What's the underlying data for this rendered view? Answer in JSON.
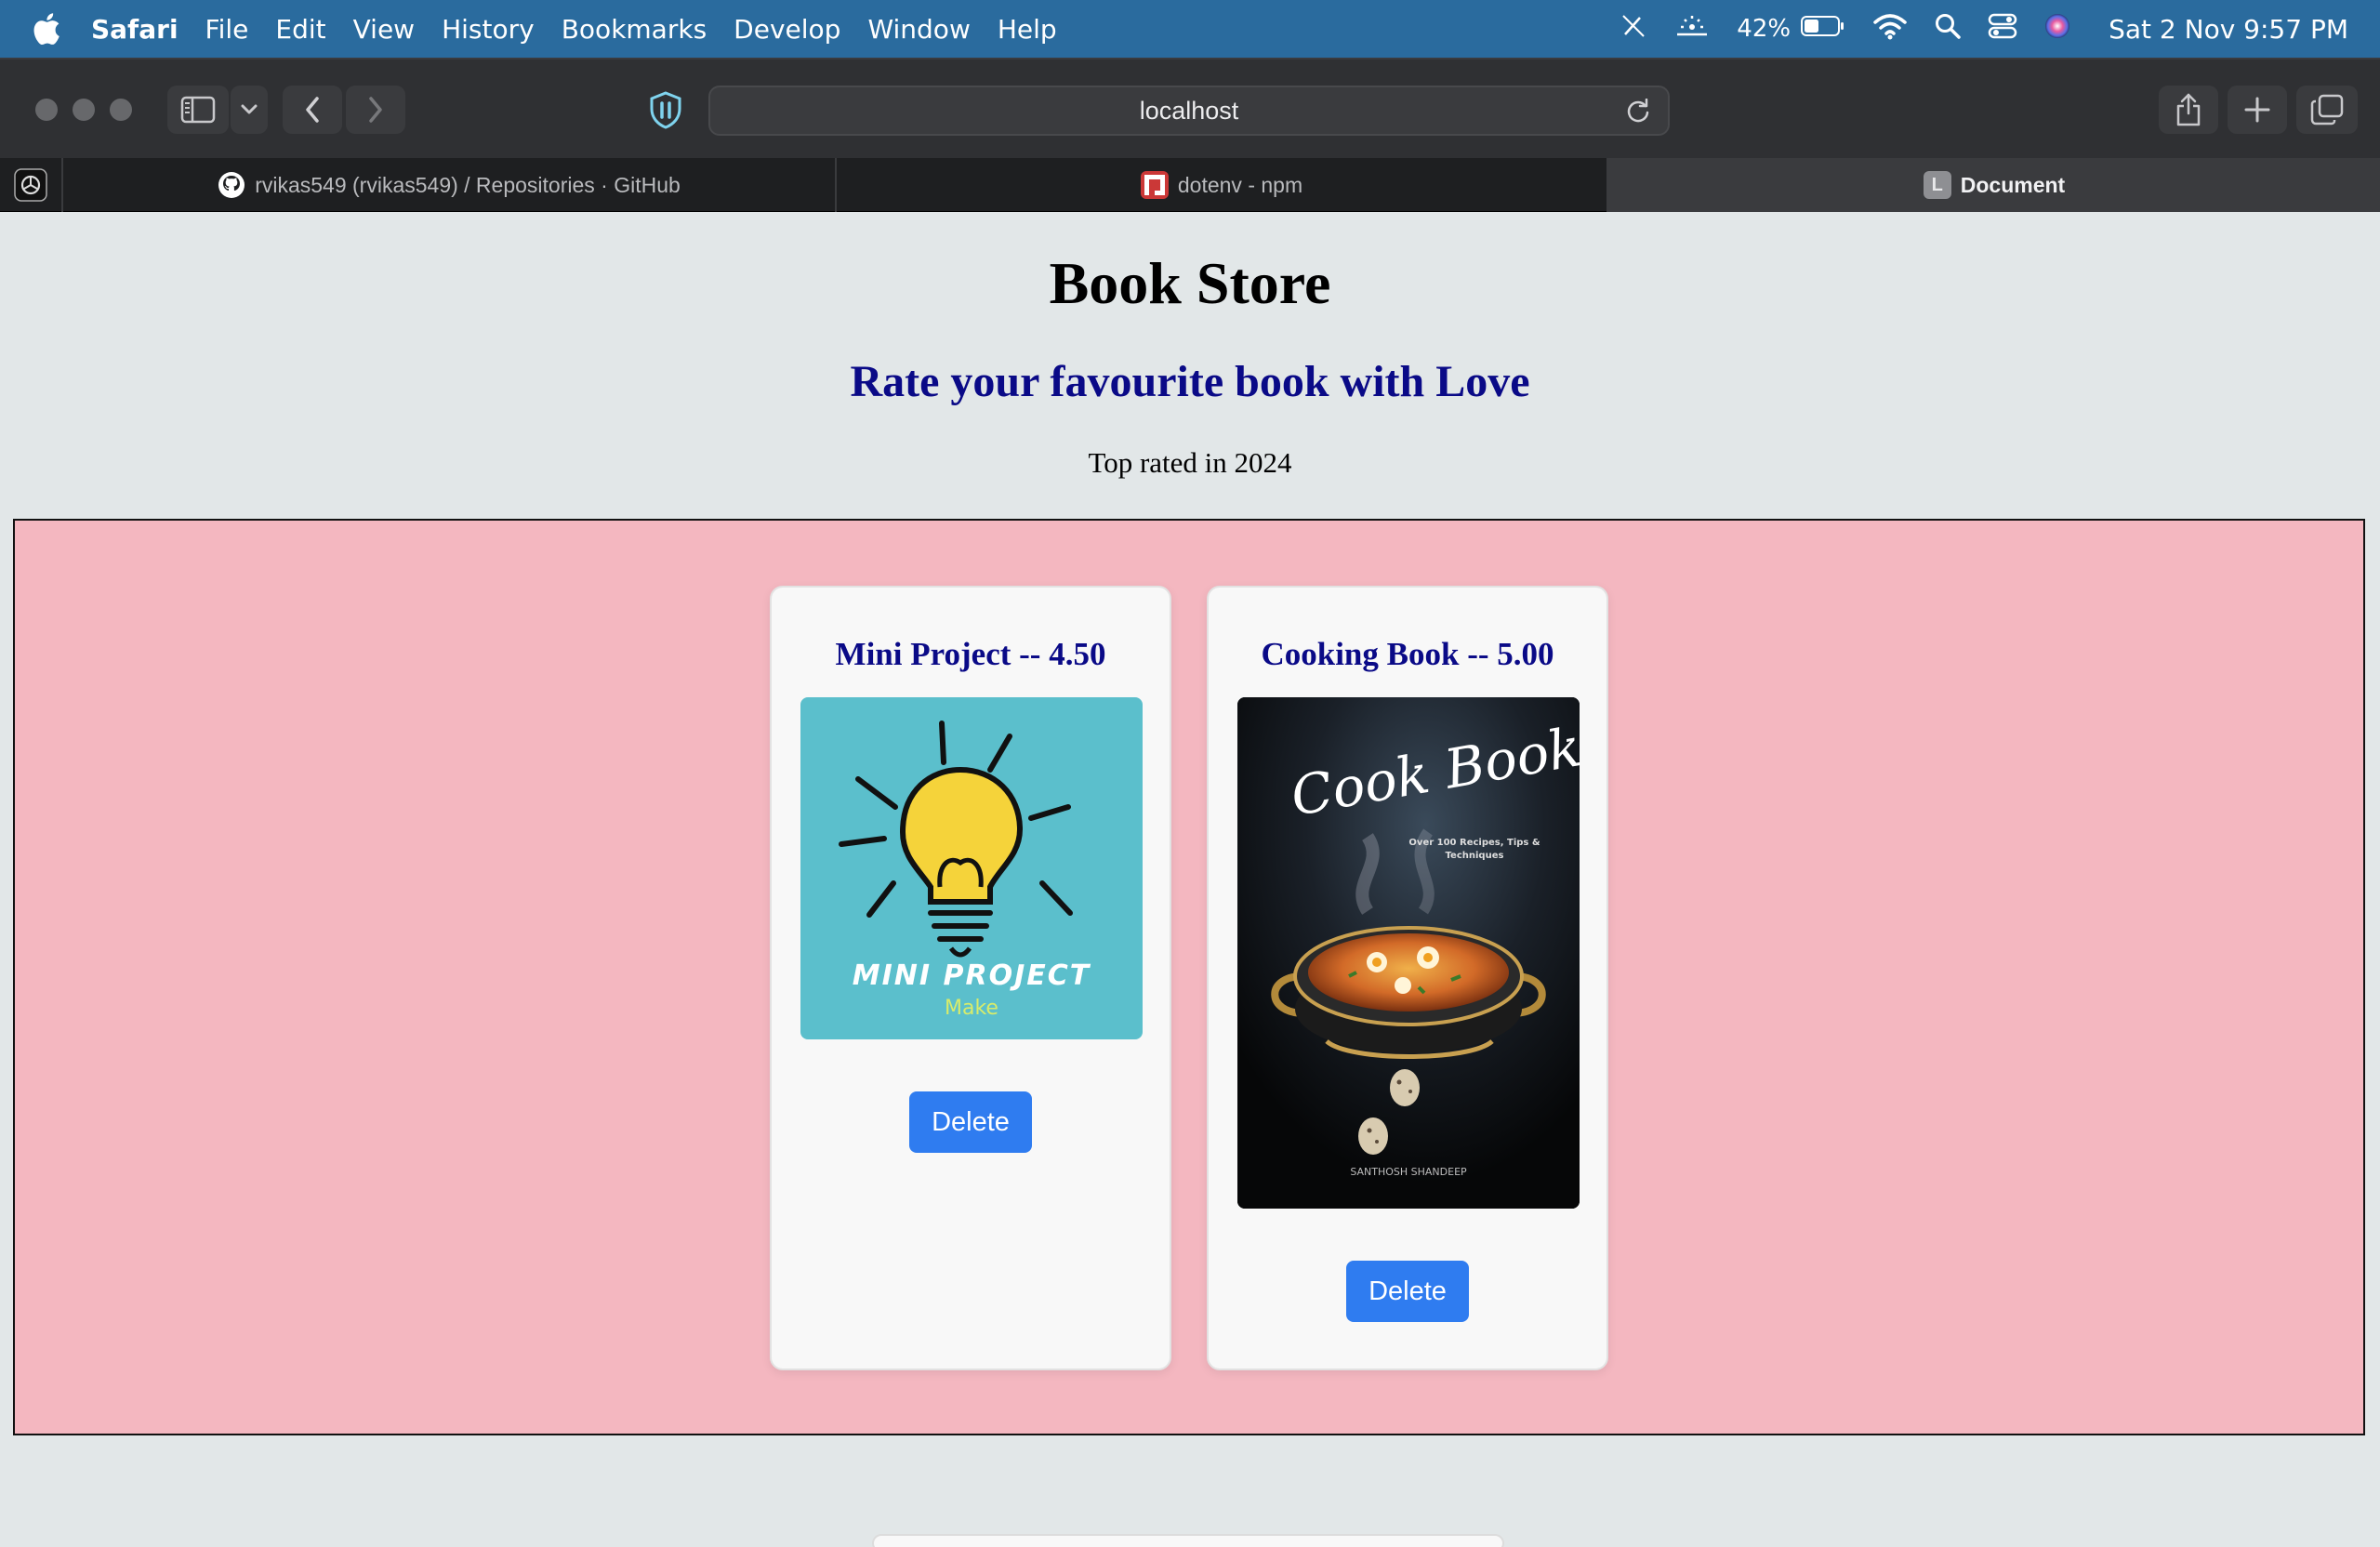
{
  "menubar": {
    "app_name": "Safari",
    "items": [
      "File",
      "Edit",
      "View",
      "History",
      "Bookmarks",
      "Develop",
      "Window",
      "Help"
    ],
    "battery_percent": "42%",
    "clock": "Sat 2 Nov  9:57 PM"
  },
  "toolbar": {
    "url": "localhost"
  },
  "tabs": [
    {
      "label": "rvikas549 (rvikas549) / Repositories · GitHub",
      "icon": "github-icon"
    },
    {
      "label": "dotenv - npm",
      "icon": "npm-icon"
    },
    {
      "label": "Document",
      "icon": "document-icon",
      "favicon_letter": "L",
      "active": true
    }
  ],
  "page": {
    "title": "Book Store",
    "subtitle": "Rate your favourite book with Love",
    "tagline": "Top rated in 2024",
    "subtitle_color": "#0a0a87",
    "card_area_color": "#f4b7c0"
  },
  "books": [
    {
      "title": "Mini Project -- 4.50",
      "cover_text": "MINI PROJECT",
      "cover_subtext": "Make",
      "delete_label": "Delete"
    },
    {
      "title": "Cooking Book -- 5.00",
      "cover_text": "Cook Book",
      "cover_subtext": "Over 100 Recipes, Tips & Techniques",
      "cover_author": "SANTHOSH SHANDEEP",
      "delete_label": "Delete"
    }
  ],
  "colors": {
    "accent_button": "#2f7cf0",
    "menubar": "#2a6b9e"
  }
}
